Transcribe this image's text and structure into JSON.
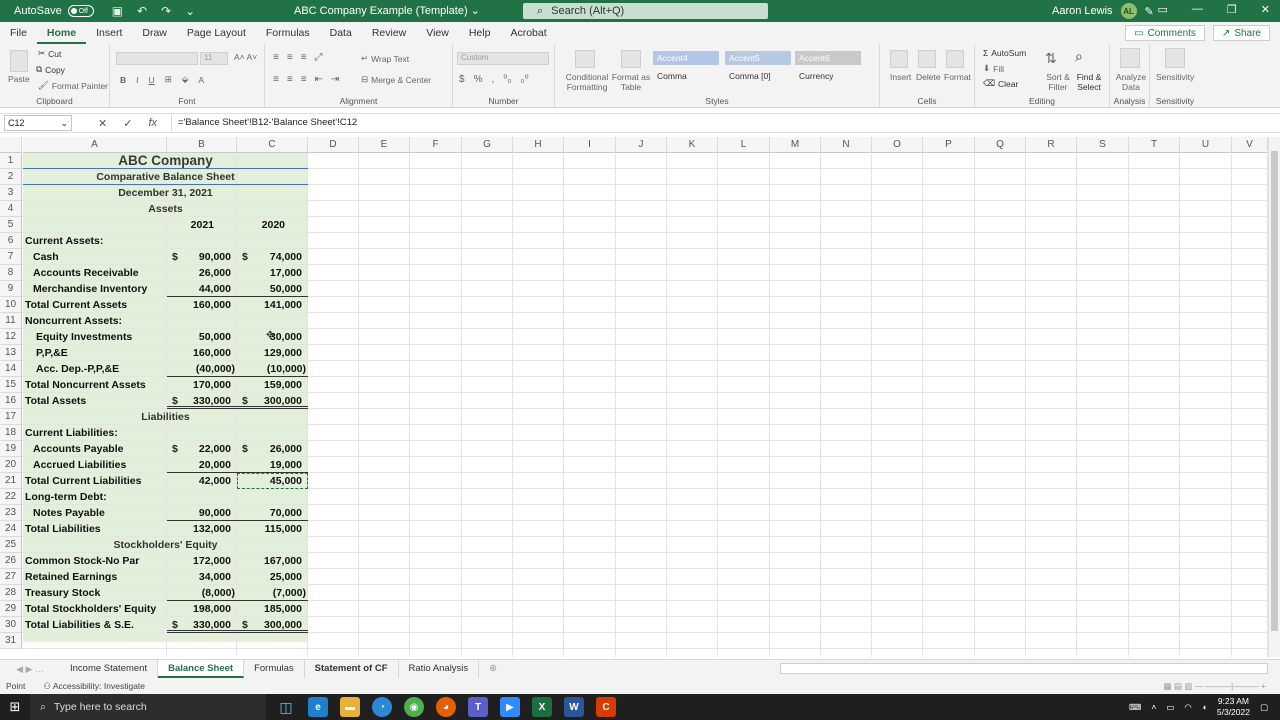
{
  "titlebar": {
    "autosave_label": "AutoSave",
    "autosave_state": "Off",
    "doc_title": "ABC Company Example (Template)",
    "search_placeholder": "Search (Alt+Q)",
    "user_name": "Aaron Lewis",
    "user_initials": "AL"
  },
  "menu": {
    "items": [
      "File",
      "Home",
      "Insert",
      "Draw",
      "Page Layout",
      "Formulas",
      "Data",
      "Review",
      "View",
      "Help",
      "Acrobat"
    ],
    "comments": "Comments",
    "share": "Share"
  },
  "ribbon": {
    "clipboard": {
      "label": "Clipboard",
      "paste": "Paste",
      "cut": "Cut",
      "copy": "Copy",
      "format_painter": "Format Painter"
    },
    "font": {
      "label": "Font",
      "size": "11"
    },
    "alignment": {
      "label": "Alignment",
      "wrap": "Wrap Text",
      "merge": "Merge & Center"
    },
    "number": {
      "label": "Number",
      "format": "Custom"
    },
    "styles": {
      "label": "Styles",
      "conditional": "Conditional Formatting",
      "format_table": "Format as Table",
      "accent4": "Accent4",
      "accent5": "Accent5",
      "accent6": "Accent6",
      "comma": "Comma",
      "comma0": "Comma [0]",
      "currency": "Currency"
    },
    "cells": {
      "label": "Cells",
      "insert": "Insert",
      "delete": "Delete",
      "format": "Format"
    },
    "editing": {
      "label": "Editing",
      "autosum": "AutoSum",
      "fill": "Fill",
      "clear": "Clear",
      "sort": "Sort & Filter",
      "find": "Find & Select"
    },
    "analysis": {
      "label": "Analysis",
      "analyze": "Analyze Data"
    },
    "sensitivity": {
      "label": "Sensitivity",
      "sens": "Sensitivity"
    }
  },
  "formula_bar": {
    "name_box": "C12",
    "formula": "='Balance Sheet'!B12-'Balance Sheet'!C12"
  },
  "columns": [
    "A",
    "B",
    "C",
    "D",
    "E",
    "F",
    "G",
    "H",
    "I",
    "J",
    "K",
    "L",
    "M",
    "N",
    "O",
    "P",
    "Q",
    "R",
    "S",
    "T",
    "U",
    "V"
  ],
  "sheet": {
    "company": "ABC Company",
    "subtitle": "Comparative Balance Sheet",
    "date": "December 31, 2021",
    "assets_header": "Assets",
    "year1": "2021",
    "year2": "2020",
    "liabilities_header": "Liabilities",
    "equity_header": "Stockholders' Equity",
    "rows": {
      "r6": {
        "label": "Current Assets:"
      },
      "r7": {
        "label": "Cash",
        "b": "90,000",
        "c": "74,000"
      },
      "r8": {
        "label": "Accounts Receivable",
        "b": "26,000",
        "c": "17,000"
      },
      "r9": {
        "label": "Merchandise Inventory",
        "b": "44,000",
        "c": "50,000"
      },
      "r10": {
        "label": "Total Current Assets",
        "b": "160,000",
        "c": "141,000"
      },
      "r11": {
        "label": "Noncurrent Assets:"
      },
      "r12": {
        "label": "Equity Investments",
        "b": "50,000",
        "c": "30,000"
      },
      "r13": {
        "label": "P,P,&E",
        "b": "160,000",
        "c": "129,000"
      },
      "r14": {
        "label": "Acc. Dep.-P,P,&E",
        "b": "(40,000)",
        "c": "(10,000)"
      },
      "r15": {
        "label": "Total Noncurrent Assets",
        "b": "170,000",
        "c": "159,000"
      },
      "r16": {
        "label": "Total Assets",
        "b": "330,000",
        "c": "300,000"
      },
      "r18": {
        "label": "Current Liabilities:"
      },
      "r19": {
        "label": "Accounts Payable",
        "b": "22,000",
        "c": "26,000"
      },
      "r20": {
        "label": "Accrued Liabilities",
        "b": "20,000",
        "c": "19,000"
      },
      "r21": {
        "label": "Total Current Liabilities",
        "b": "42,000",
        "c": "45,000"
      },
      "r22": {
        "label": "Long-term Debt:"
      },
      "r23": {
        "label": "Notes Payable",
        "b": "90,000",
        "c": "70,000"
      },
      "r24": {
        "label": "Total Liabilities",
        "b": "132,000",
        "c": "115,000"
      },
      "r26": {
        "label": "Common Stock-No Par",
        "b": "172,000",
        "c": "167,000"
      },
      "r27": {
        "label": "Retained Earnings",
        "b": "34,000",
        "c": "25,000"
      },
      "r28": {
        "label": "Treasury Stock",
        "b": "(8,000)",
        "c": "(7,000)"
      },
      "r29": {
        "label": "Total Stockholders' Equity",
        "b": "198,000",
        "c": "185,000"
      },
      "r30": {
        "label": "Total Liabilities & S.E.",
        "b": "330,000",
        "c": "300,000"
      }
    },
    "dollar": "$"
  },
  "tabs": [
    "Income Statement",
    "Balance Sheet",
    "Formulas",
    "Statement of CF",
    "Ratio Analysis"
  ],
  "status": {
    "mode": "Point",
    "accessibility": "Accessibility: Investigate"
  },
  "taskbar": {
    "search_placeholder": "Type here to search",
    "time": "9:23 AM",
    "date": "5/3/2022"
  }
}
